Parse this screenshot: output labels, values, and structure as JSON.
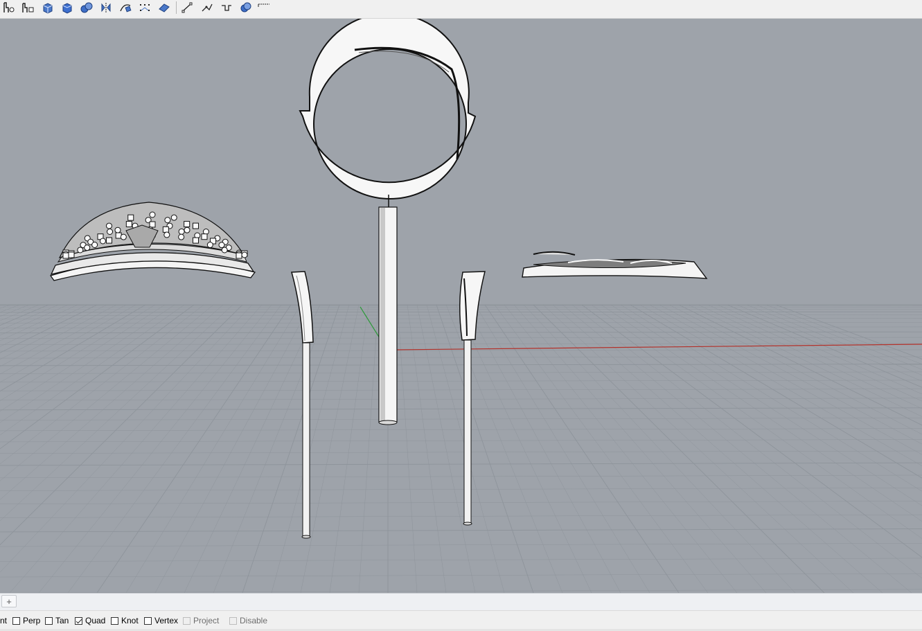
{
  "toolbar": {
    "buttons": [
      {
        "name": "select-points-icon"
      },
      {
        "name": "select-objects-icon"
      },
      {
        "name": "box-icon"
      },
      {
        "name": "solid-icon"
      },
      {
        "name": "spheres-icon"
      },
      {
        "name": "mirror-icon"
      },
      {
        "name": "sweep-icon"
      },
      {
        "name": "control-points-icon"
      },
      {
        "name": "surface-icon"
      },
      {
        "name": "line-icon"
      },
      {
        "name": "polyline-icon"
      },
      {
        "name": "curve-icon"
      },
      {
        "name": "boolean-icon"
      },
      {
        "name": "more-icon"
      }
    ]
  },
  "viewport": {
    "background": "#9ea3aa",
    "grid_color": "#8e949b",
    "x_axis_color": "#b3312a",
    "y_axis_color": "#2f9a3c",
    "objects": [
      "ring-shank-with-stem",
      "crown-head-pave",
      "left-prong-stem",
      "right-prong-stem",
      "flat-band-piece"
    ]
  },
  "tabbar": {
    "add_label": "+"
  },
  "osnap": {
    "items": [
      {
        "label": "nt",
        "checked": null,
        "disabled": false
      },
      {
        "label": "Perp",
        "checked": false,
        "disabled": false
      },
      {
        "label": "Tan",
        "checked": false,
        "disabled": false
      },
      {
        "label": "Quad",
        "checked": true,
        "disabled": false
      },
      {
        "label": "Knot",
        "checked": false,
        "disabled": false
      },
      {
        "label": "Vertex",
        "checked": false,
        "disabled": false
      },
      {
        "label": "Project",
        "checked": false,
        "disabled": true
      },
      {
        "label": "Disable",
        "checked": false,
        "disabled": true
      }
    ]
  }
}
